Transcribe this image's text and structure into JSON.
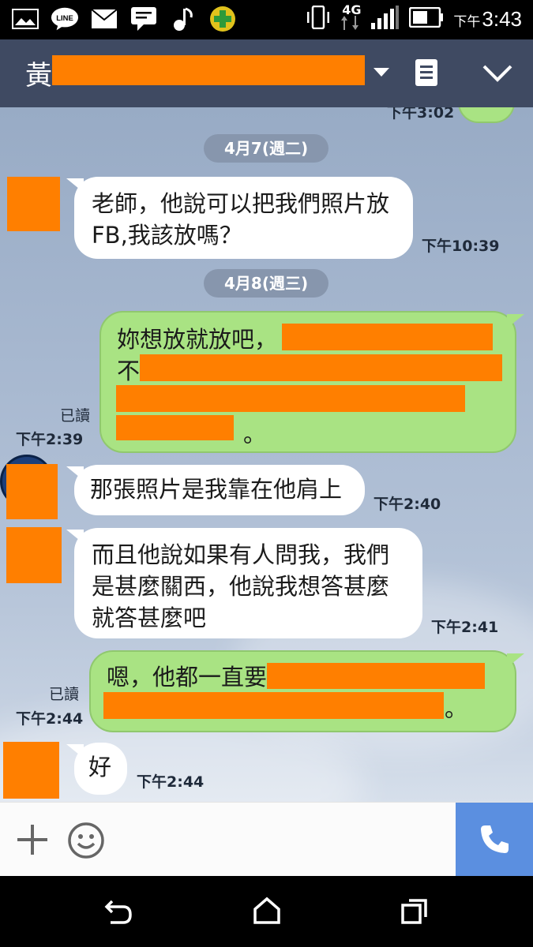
{
  "status_bar": {
    "time_prefix": "下午",
    "time": "3:43",
    "network": "4G",
    "line_label": "LINE"
  },
  "header": {
    "contact_name": "黃",
    "menu_icon": "note-icon",
    "collapse_icon": "chevron-down-icon"
  },
  "chat": {
    "partial_time": "下午3:02",
    "dates": [
      "4月7(週二)",
      "4月8(週三)"
    ],
    "messages": [
      {
        "side": "in",
        "lines": [
          "老師，他說可以把我們照片放",
          "FB,我該放嗎？"
        ],
        "time": "下午10:39"
      },
      {
        "side": "out",
        "lines": [
          "妳想放就放吧，",
          "不",
          "",
          "。"
        ],
        "read": "已讀",
        "time": "下午2:39"
      },
      {
        "side": "in",
        "lines": [
          "那張照片是我靠在他肩上"
        ],
        "time": "下午2:40"
      },
      {
        "side": "in",
        "lines": [
          "而且他說如果有人問我，我們",
          "是甚麼關西，他說我想答甚麼",
          "就答甚麼吧"
        ],
        "time": "下午2:41"
      },
      {
        "side": "out",
        "lines": [
          "嗯，他都一直要",
          "。"
        ],
        "read": "已讀",
        "time": "下午2:44"
      },
      {
        "side": "in",
        "lines": [
          "好"
        ],
        "time": "下午2:44"
      }
    ]
  },
  "input_bar": {
    "add_icon": "plus-icon",
    "emoji_icon": "smiley-icon",
    "call_icon": "phone-icon",
    "call_color": "#5b8fe0"
  },
  "nav_bar": {
    "back_icon": "back-icon",
    "home_icon": "home-icon",
    "recents_icon": "recents-icon"
  },
  "colors": {
    "header_bg": "#3f4a62",
    "outgoing_bubble": "#a9e383",
    "incoming_bubble": "#ffffff",
    "redaction": "#ff7f00"
  }
}
